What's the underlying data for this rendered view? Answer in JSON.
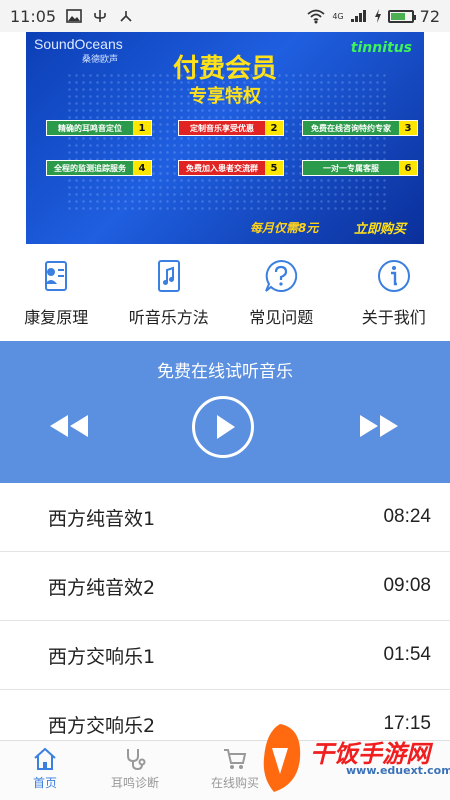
{
  "status_bar": {
    "time": "11:05",
    "network": "4G",
    "battery": "72",
    "battery_level": 0.72
  },
  "banner": {
    "brand": "SoundOceans",
    "brand_sub": "桑德欧声",
    "badge": "tinnitus",
    "title": "付费会员",
    "subtitle": "专享特权",
    "features": [
      {
        "text": "精确的耳鸣音定位",
        "num": "1",
        "bg": "#2b9a4a"
      },
      {
        "text": "定制音乐享受优惠",
        "num": "2",
        "bg": "#e02424"
      },
      {
        "text": "免费在线咨询特约专家",
        "num": "3",
        "bg": "#2b9a4a"
      },
      {
        "text": "全程的监测追踪服务",
        "num": "4",
        "bg": "#2b9a4a"
      },
      {
        "text": "免费加入患者交流群",
        "num": "5",
        "bg": "#e02424"
      },
      {
        "text": "一对一专属客服",
        "num": "6",
        "bg": "#2b9a4a"
      }
    ],
    "price": "每月仅需8元",
    "buy": "立即购买"
  },
  "menu": [
    {
      "label": "康复原理",
      "icon": "document-person-icon"
    },
    {
      "label": "听音乐方法",
      "icon": "music-note-icon"
    },
    {
      "label": "常见问题",
      "icon": "question-icon"
    },
    {
      "label": "关于我们",
      "icon": "info-icon"
    }
  ],
  "player": {
    "title": "免费在线试听音乐"
  },
  "tracks": [
    {
      "name": "西方纯音效1",
      "duration": "08:24"
    },
    {
      "name": "西方纯音效2",
      "duration": "09:08"
    },
    {
      "name": "西方交响乐1",
      "duration": "01:54"
    },
    {
      "name": "西方交响乐2",
      "duration": "17:15"
    }
  ],
  "bottom_nav": [
    {
      "label": "首页",
      "icon": "home-icon",
      "active": true
    },
    {
      "label": "耳鸣诊断",
      "icon": "stethoscope-icon",
      "active": false
    },
    {
      "label": "在线购买",
      "icon": "cart-icon",
      "active": false
    }
  ],
  "watermark": {
    "text": "干饭手游网",
    "url": "www.eduext.com"
  },
  "colors": {
    "accent": "#3b7fe0",
    "player_bg": "#5b8fe0",
    "banner_yellow": "#ffe11a",
    "badge_green": "#3df25a"
  }
}
